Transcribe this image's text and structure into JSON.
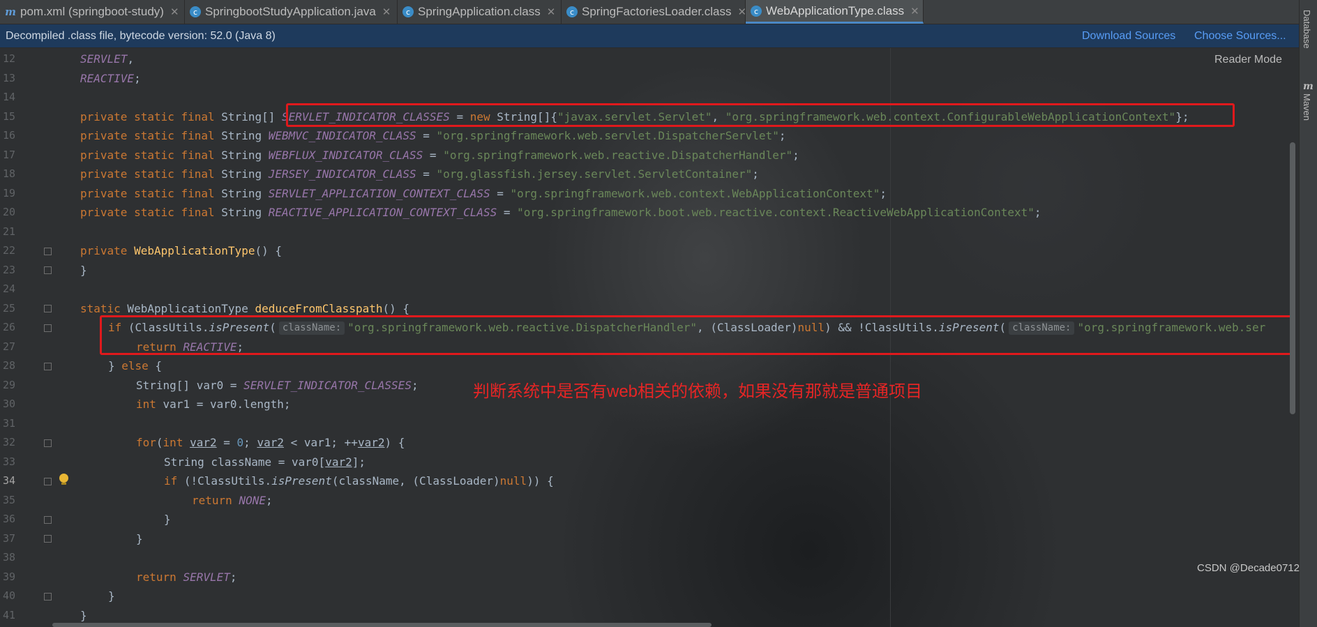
{
  "tabs": [
    {
      "label": "pom.xml (springboot-study)",
      "icon": "maven-icon",
      "active": false
    },
    {
      "label": "SpringbootStudyApplication.java",
      "icon": "class-icon",
      "active": false
    },
    {
      "label": "SpringApplication.class",
      "icon": "class-icon",
      "active": false
    },
    {
      "label": "SpringFactoriesLoader.class",
      "icon": "class-icon",
      "active": false
    },
    {
      "label": "WebApplicationType.class",
      "icon": "class-icon",
      "active": true
    }
  ],
  "infobar": {
    "message": "Decompiled .class file, bytecode version: 52.0 (Java 8)",
    "download_sources": "Download Sources",
    "choose_sources": "Choose Sources..."
  },
  "sidebar": {
    "database": "Database",
    "maven": "Maven"
  },
  "editor": {
    "reader_mode": "Reader Mode",
    "line_numbers": [
      "12",
      "13",
      "14",
      "15",
      "16",
      "17",
      "18",
      "19",
      "20",
      "21",
      "22",
      "23",
      "24",
      "25",
      "26",
      "27",
      "28",
      "29",
      "30",
      "31",
      "32",
      "33",
      "34",
      "35",
      "36",
      "37",
      "38",
      "39",
      "40",
      "41"
    ],
    "current_line": "34",
    "strings": {
      "servlet_class": "\"javax.servlet.Servlet\"",
      "configurable_ctx": "\"org.springframework.web.context.ConfigurableWebApplicationContext\"",
      "dispatcher_servlet": "\"org.springframework.web.servlet.DispatcherServlet\"",
      "dispatcher_handler": "\"org.springframework.web.reactive.DispatcherHandler\"",
      "jersey_container": "\"org.glassfish.jersey.servlet.ServletContainer\"",
      "web_app_ctx": "\"org.springframework.web.context.WebApplicationContext\"",
      "reactive_web_ctx": "\"org.springframework.boot.web.reactive.context.ReactiveWebApplicationContext\"",
      "truncated_servlet": "\"org.springframework.web.ser"
    },
    "param_hint": "className:",
    "annotation": "判断系统中是否有web相关的依赖，如果没有那就是普通项目"
  },
  "watermark": "CSDN @Decade0712",
  "colors": {
    "background": "#2b2b2b",
    "keyword": "#cc7832",
    "constant": "#9876aa",
    "string": "#6a8759",
    "method": "#ffc66d",
    "highlight_box": "#e0191c"
  }
}
